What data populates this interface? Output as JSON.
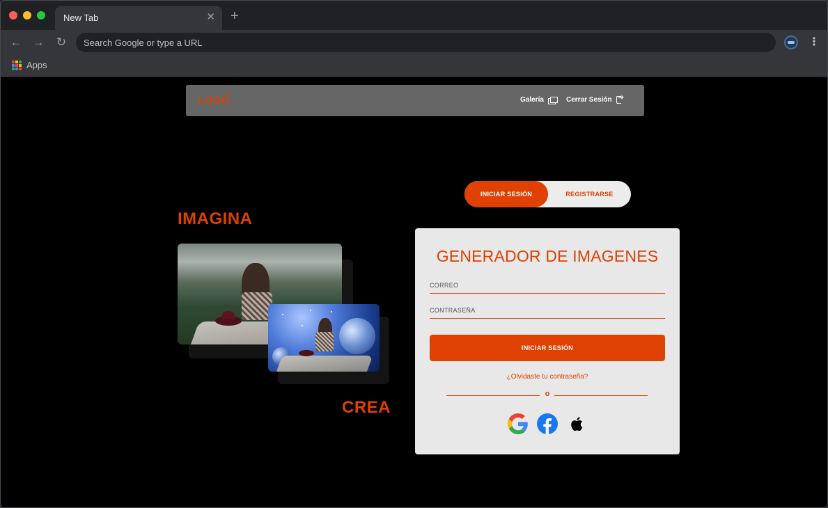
{
  "browser": {
    "tab_title": "New Tab",
    "tab_close": "✕",
    "new_tab": "+",
    "omnibox_placeholder": "Search Google or type a URL",
    "bookmarks": {
      "apps_label": "Apps"
    },
    "icons": {
      "back": "←",
      "forward": "→",
      "reload": "↻",
      "menu": "⋮"
    }
  },
  "header": {
    "logo": "LOGO",
    "links": [
      {
        "label": "Galería",
        "icon": "gallery-icon"
      },
      {
        "label": "Cerrar Sesión",
        "icon": "logout-icon"
      }
    ]
  },
  "hero": {
    "word_top": "IMAGINA",
    "word_bottom": "CREA"
  },
  "auth_toggle": {
    "login": "INICIAR SESIÓN",
    "register": "REGISTRARSE",
    "active": "login"
  },
  "login_card": {
    "title": "GENERADOR DE IMAGENES",
    "email_placeholder": "CORREO",
    "password_placeholder": "CONTRASEÑA",
    "submit_label": "INICIAR SESIÓN",
    "forgot_link": "¿Olvidaste tu contraseña?",
    "divider": "o",
    "social": [
      "google-icon",
      "facebook-icon",
      "apple-icon"
    ]
  },
  "colors": {
    "accent": "#e04000",
    "header_bg": "#666666",
    "card_bg": "#e8e8e8",
    "page_bg": "#000000"
  }
}
